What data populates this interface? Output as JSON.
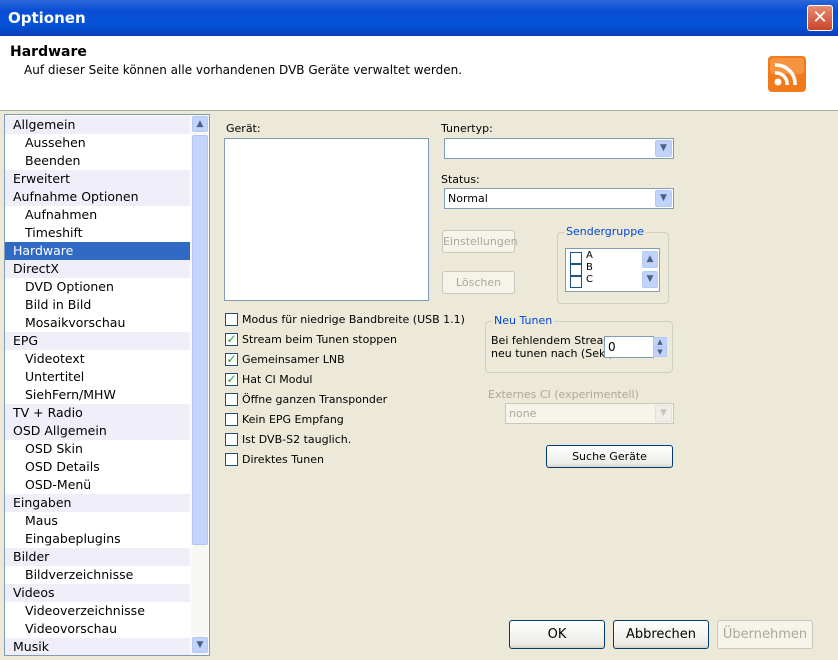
{
  "window": {
    "title": "Optionen",
    "close_glyph": "✕"
  },
  "header": {
    "title": "Hardware",
    "subtitle": "Auf dieser Seite können alle vorhandenen DVB Geräte verwaltet werden.",
    "icon": "rss-icon"
  },
  "sidebar": {
    "items": [
      {
        "label": "Allgemein",
        "level": "cat"
      },
      {
        "label": "Aussehen",
        "level": "sub"
      },
      {
        "label": "Beenden",
        "level": "sub"
      },
      {
        "label": "Erweitert",
        "level": "cat"
      },
      {
        "label": "Aufnahme Optionen",
        "level": "cat"
      },
      {
        "label": "Aufnahmen",
        "level": "sub"
      },
      {
        "label": "Timeshift",
        "level": "sub"
      },
      {
        "label": "Hardware",
        "level": "cat",
        "selected": true
      },
      {
        "label": "DirectX",
        "level": "cat"
      },
      {
        "label": "DVD Optionen",
        "level": "sub"
      },
      {
        "label": "Bild in Bild",
        "level": "sub"
      },
      {
        "label": "Mosaikvorschau",
        "level": "sub"
      },
      {
        "label": "EPG",
        "level": "cat"
      },
      {
        "label": "Videotext",
        "level": "sub"
      },
      {
        "label": "Untertitel",
        "level": "sub"
      },
      {
        "label": "SiehFern/MHW",
        "level": "sub"
      },
      {
        "label": "TV + Radio",
        "level": "cat"
      },
      {
        "label": "OSD Allgemein",
        "level": "cat"
      },
      {
        "label": "OSD Skin",
        "level": "sub"
      },
      {
        "label": "OSD Details",
        "level": "sub"
      },
      {
        "label": "OSD-Menü",
        "level": "sub"
      },
      {
        "label": "Eingaben",
        "level": "cat"
      },
      {
        "label": "Maus",
        "level": "sub"
      },
      {
        "label": "Eingabeplugins",
        "level": "sub"
      },
      {
        "label": "Bilder",
        "level": "cat"
      },
      {
        "label": "Bildverzeichnisse",
        "level": "sub"
      },
      {
        "label": "Videos",
        "level": "cat"
      },
      {
        "label": "Videoverzeichnisse",
        "level": "sub"
      },
      {
        "label": "Videovorschau",
        "level": "sub"
      },
      {
        "label": "Musik",
        "level": "cat"
      }
    ]
  },
  "main": {
    "device_label": "Gerät:",
    "tuner_type_label": "Tunertyp:",
    "tuner_type_value": "",
    "status_label": "Status:",
    "status_value": "Normal",
    "settings_button": "Einstellungen",
    "delete_button": "Löschen",
    "channel_group": {
      "legend": "Sendergruppe",
      "options": [
        "A",
        "B",
        "C"
      ]
    },
    "checkboxes": [
      {
        "label": "Modus für niedrige Bandbreite (USB 1.1)",
        "checked": false
      },
      {
        "label": "Stream beim Tunen stoppen",
        "checked": true
      },
      {
        "label": "Gemeinsamer LNB",
        "checked": true
      },
      {
        "label": "Hat CI Modul",
        "checked": true
      },
      {
        "label": "Öffne ganzen Transponder",
        "checked": false
      },
      {
        "label": "Kein EPG Empfang",
        "checked": false
      },
      {
        "label": "Ist DVB-S2 tauglich.",
        "checked": false
      },
      {
        "label": "Direktes Tunen",
        "checked": false
      }
    ],
    "retune": {
      "legend": "Neu Tunen",
      "text_line1": "Bei fehlendem Stream",
      "text_line2": "neu tunen nach (Sek.)",
      "value": "0"
    },
    "external_ci": {
      "label": "Externes CI (experimentell)",
      "value": "none"
    },
    "search_devices_button": "Suche Geräte"
  },
  "footer": {
    "ok": "OK",
    "cancel": "Abbrechen",
    "apply": "Übernehmen"
  }
}
